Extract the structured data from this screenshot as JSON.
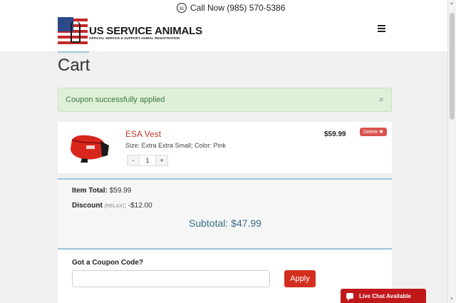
{
  "header": {
    "phone_label": "Call Now (985) 570-5386",
    "logo_title": "US SERVICE ANIMALS",
    "logo_subtitle": "OFFICIAL SERVICE & SUPPORT ANIMAL REGISTRATION"
  },
  "page": {
    "title": "Cart"
  },
  "alert": {
    "message": "Coupon successfully applied",
    "close": "×"
  },
  "cart_item": {
    "name": "ESA Vest",
    "variant": "Size: Extra Extra Small; Color: Pink",
    "quantity": "1",
    "decrement": "-",
    "increment": "+",
    "price": "$59.99",
    "delete_label": "Delete ✖"
  },
  "totals": {
    "item_total_label": "Item Total:",
    "item_total_value": "$59.99",
    "discount_label": "Discount",
    "discount_code": "(RELAX)",
    "discount_value": ": -$12.00",
    "subtotal": "Subtotal: $47.99"
  },
  "coupon": {
    "label": "Got a Coupon Code?",
    "input_value": "",
    "apply_label": "Apply"
  },
  "live_chat": {
    "label": "Live Chat Available"
  },
  "colors": {
    "accent_red": "#d32f1e",
    "success_bg": "#dff0d8",
    "success_text": "#3c763d",
    "divider_blue": "#9cc8dc",
    "subtotal_blue": "#3a6c8a"
  }
}
